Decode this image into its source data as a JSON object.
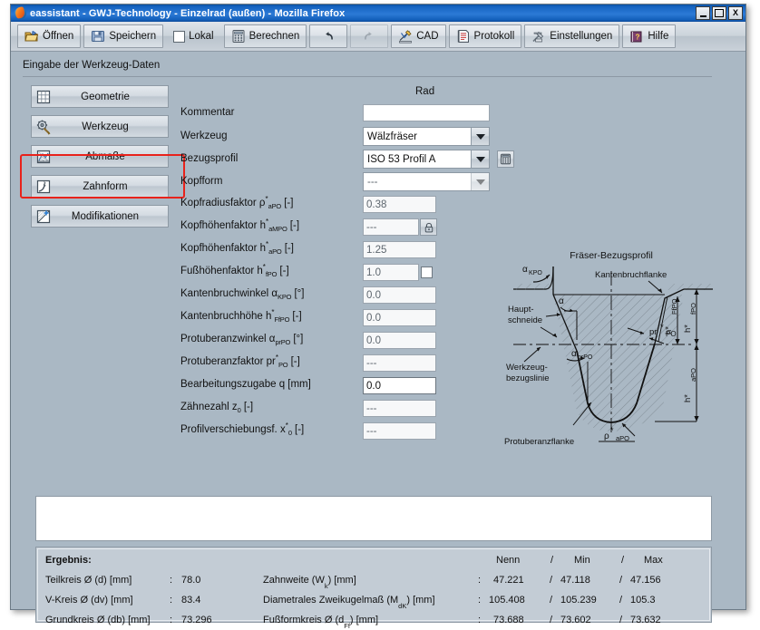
{
  "window": {
    "title": "eassistant - GWJ-Technology - Einzelrad (außen) - Mozilla Firefox",
    "app_icon": "firefox-icon",
    "controls": {
      "minimize": "minimize-icon",
      "maximize": "maximize-icon",
      "close": "X"
    }
  },
  "toolbar": {
    "buttons": [
      {
        "label": "Öffnen",
        "icon": "open-folder-icon",
        "enabled": true
      },
      {
        "label": "Speichern",
        "icon": "floppy-disk-icon",
        "enabled": true
      },
      {
        "label": "Lokal",
        "icon": "checkbox-icon",
        "enabled": true,
        "checked": false,
        "type": "checkbox"
      },
      {
        "label": "Berechnen",
        "icon": "calculator-icon",
        "enabled": true
      },
      {
        "label": "",
        "icon": "undo-arrow-icon",
        "enabled": true
      },
      {
        "label": "",
        "icon": "redo-arrow-icon",
        "enabled": false
      },
      {
        "label": "CAD",
        "icon": "cad-pencil-icon",
        "enabled": true
      },
      {
        "label": "Protokoll",
        "icon": "document-icon",
        "enabled": true
      },
      {
        "label": "Einstellungen",
        "icon": "tools-icon",
        "enabled": true
      },
      {
        "label": "Hilfe",
        "icon": "help-book-icon",
        "enabled": true
      }
    ]
  },
  "section": {
    "title": "Eingabe der Werkzeug-Daten"
  },
  "sidebar": {
    "items": [
      {
        "label": "Geometrie",
        "icon": "grid-icon",
        "selected": false
      },
      {
        "label": "Werkzeug",
        "icon": "gear-tool-icon",
        "selected": true
      },
      {
        "label": "Abmaße",
        "icon": "chart-icon",
        "selected": false
      },
      {
        "label": "Zahnform",
        "icon": "tooth-curve-icon",
        "selected": false
      },
      {
        "label": "Modifikationen",
        "icon": "modify-icon",
        "selected": false
      }
    ],
    "highlight": "Werkzeug"
  },
  "form": {
    "column_header": "Rad",
    "rows": [
      {
        "label_html": "Kommentar",
        "value": "",
        "kind": "text",
        "extra": null
      },
      {
        "label_html": "Werkzeug",
        "value": "Wälzfräser",
        "kind": "combo",
        "extra": null
      },
      {
        "label_html": "Bezugsprofil",
        "value": "ISO 53 Profil A",
        "kind": "combo",
        "extra": "calculator-button"
      },
      {
        "label_html": "Kopfform",
        "value": "---",
        "kind": "combo-dim",
        "extra": null
      },
      {
        "label_html": "Kopfradiusfaktor &rho;<sup>*</sup><sub>aPO</sub> [-]",
        "value": "0.38",
        "kind": "readonly",
        "extra": null
      },
      {
        "label_html": "Kopfhöhenfaktor h<sup>*</sup><sub>aMPO</sub> [-]",
        "value": "---",
        "kind": "readonly",
        "extra": "lock-button"
      },
      {
        "label_html": "Kopfhöhenfaktor h<sup>*</sup><sub>aPO</sub> [-]",
        "value": "1.25",
        "kind": "readonly",
        "extra": null
      },
      {
        "label_html": "Fußhöhenfaktor h<sup>*</sup><sub>fPO</sub> [-]",
        "value": "1.0",
        "kind": "readonly",
        "extra": "checkbox"
      },
      {
        "label_html": "Kantenbruchwinkel &alpha;<sub>KPO</sub> [°]",
        "value": "0.0",
        "kind": "readonly",
        "extra": null
      },
      {
        "label_html": "Kantenbruchhöhe h<sup>*</sup><sub>FfPO</sub> [-]",
        "value": "0.0",
        "kind": "readonly",
        "extra": null
      },
      {
        "label_html": "Protuberanzwinkel &alpha;<sub>prPO</sub> [°]",
        "value": "0.0",
        "kind": "readonly",
        "extra": null
      },
      {
        "label_html": "Protuberanzfaktor pr<sup>*</sup><sub>PO</sub> [-]",
        "value": "---",
        "kind": "readonly",
        "extra": null
      },
      {
        "label_html": "Bearbeitungszugabe q [mm]",
        "value": "0.0",
        "kind": "active",
        "extra": null
      },
      {
        "label_html": "Zähnezahl z<sub>0</sub> [-]",
        "value": "---",
        "kind": "readonly",
        "extra": null
      },
      {
        "label_html": "Profilverschiebungsf. x<sup>*</sup><sub>0</sub> [-]",
        "value": "---",
        "kind": "readonly",
        "extra": null
      }
    ]
  },
  "diagram": {
    "title": "Fräser-Bezugsprofil",
    "labels": {
      "alpha_kpo": "α",
      "alpha_kpo_sub": "KPO",
      "kantenbruchflanke": "Kantenbruchflanke",
      "hauptschneide_1": "Haupt-",
      "hauptschneide_2": "schneide",
      "alpha": "α",
      "werkzeug_1": "Werkzeug-",
      "werkzeug_2": "bezugslinie",
      "alpha_prpo": "α",
      "alpha_prpo_sub": "prPO",
      "pr_po": "pr*",
      "pr_po_sub": "PO",
      "h_ffpo": "h*",
      "h_ffpo_sub": "FfPO",
      "h_fpo": "h*",
      "h_fpo_sub": "fPO",
      "h_apo": "h*",
      "h_apo_sub": "aPO",
      "rho_apo": "ρ*",
      "rho_apo_sub": "aPO",
      "protuberanzflanke": "Protuberanzflanke"
    }
  },
  "results": {
    "heading": "Ergebnis:",
    "column_headers": {
      "nenn": "Nenn",
      "sep1": "/",
      "min": "Min",
      "sep2": "/",
      "max": "Max"
    },
    "left_rows": [
      {
        "label": "Teilkreis Ø (d) [mm]",
        "sep": ":",
        "value": "78.0"
      },
      {
        "label": "V-Kreis Ø (dv) [mm]",
        "sep": ":",
        "value": "83.4"
      },
      {
        "label": "Grundkreis Ø (db) [mm]",
        "sep": ":",
        "value": "73.296"
      }
    ],
    "right_rows": [
      {
        "label_html": "Zahnweite (W<sub>k</sub>) [mm]",
        "sep": ":",
        "nenn": "47.221",
        "min": "47.118",
        "max": "47.156"
      },
      {
        "label_html": "Diametrales Zweikugelmaß (M<sub>dK</sub>) [mm]",
        "sep": ":",
        "nenn": "105.408",
        "min": "105.239",
        "max": "105.3"
      },
      {
        "label_html": "Fußformkreis Ø (d<sub>Ff</sub>) [mm]",
        "sep": ":",
        "nenn": "73.688",
        "min": "73.602",
        "max": "73.632"
      }
    ]
  },
  "colors": {
    "window_bg": "#aab8c4",
    "titlebar": "#1563c0",
    "highlight_red": "#e8221b",
    "panel_result": "#c3ccd5"
  }
}
